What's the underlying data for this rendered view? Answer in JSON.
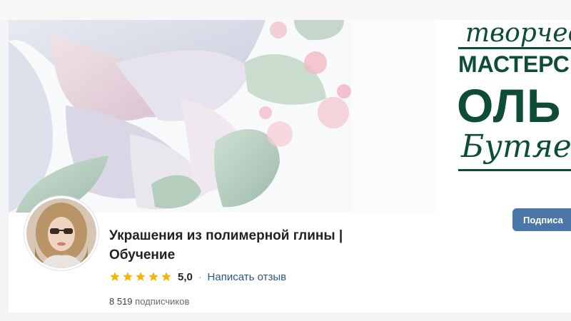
{
  "cover": {
    "lines": [
      "творчес",
      "МАСТЕРС",
      "ОЛЬ",
      "Бутяев"
    ],
    "colors": {
      "ink": "#0d4c35",
      "pink": "#f2b9c4",
      "sage": "#b9d0c1"
    }
  },
  "community": {
    "title": "Украшения из полимерной глины |\nОбучение",
    "rating_value": "5,0",
    "stars": 5,
    "separator": "·",
    "review_link": "Написать отзыв",
    "subscribers_count": "8 519",
    "subscribers_label": "подписчиков"
  },
  "actions": {
    "subscribe_label": "Подписа"
  },
  "icons": {
    "star": "star-icon"
  },
  "colors": {
    "accent": "#4a76a8",
    "link": "#2a5885",
    "star": "#f4b400"
  }
}
